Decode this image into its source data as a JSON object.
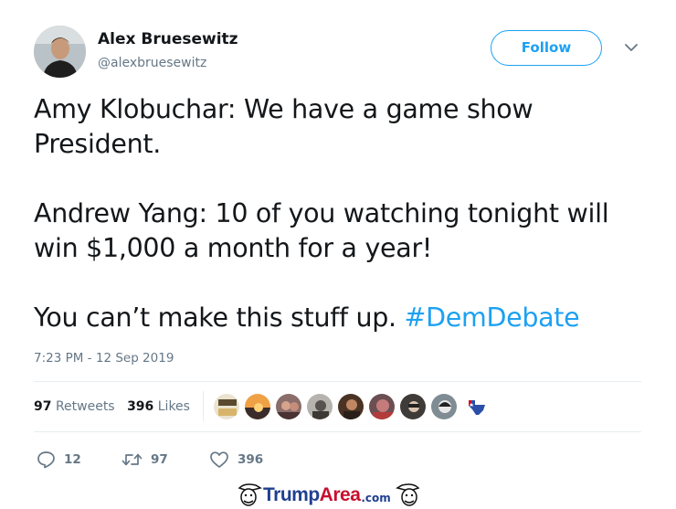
{
  "author": {
    "display_name": "Alex Bruesewitz",
    "handle": "@alexbruesewitz"
  },
  "follow_label": "Follow",
  "tweet": {
    "line1": "Amy Klobuchar: We have a game show",
    "line2": "President.",
    "line3": "Andrew Yang: 10 of you watching tonight will",
    "line4": "win $1,000 a month for a year!",
    "line5_prefix": "You can’t make this stuff up. ",
    "hashtag": "#DemDebate"
  },
  "timestamp": "7:23 PM - 12 Sep 2019",
  "stats": {
    "retweets_count": "97",
    "retweets_label": "Retweets",
    "likes_count": "396",
    "likes_label": "Likes"
  },
  "actions": {
    "reply_count": "12",
    "retweet_count": "97",
    "like_count": "396"
  },
  "watermark": {
    "trump": "Trump",
    "area": "Area",
    "com": ".com"
  },
  "colors": {
    "accent": "#1da1f2",
    "text": "#14171a",
    "secondary": "#657786",
    "divider": "#e6ecf0"
  }
}
